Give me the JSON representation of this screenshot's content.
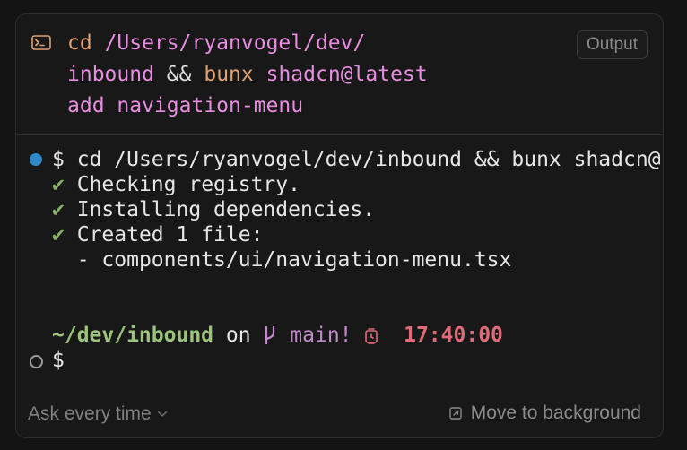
{
  "header": {
    "command_lines": [
      {
        "cd": "cd",
        "path": "/Users/ryanvogel/dev/"
      },
      {
        "dir": "inbound",
        "op": "&&",
        "bunx": "bunx",
        "pkg": "shadcn@latest"
      },
      {
        "rest": "add navigation-menu"
      }
    ],
    "output_label": "Output"
  },
  "terminal": {
    "prompt": "$",
    "command": "cd /Users/ryanvogel/dev/inbound && bunx shadcn@",
    "check_mark": "✔",
    "lines": [
      "Checking registry.",
      "Installing dependencies.",
      "Created 1 file:"
    ],
    "file_line": "- components/ui/navigation-menu.tsx",
    "status": {
      "path": "~/dev/inbound",
      "on": "on",
      "branch": "main!",
      "time": "17:40:00"
    },
    "prompt2": "$"
  },
  "footer": {
    "ask_label": "Ask every time",
    "move_label": "Move to background"
  },
  "colors": {
    "accent_dot": "#2e8ac8",
    "check": "#8ab06a",
    "path": "#9cc37a",
    "branch": "#c48ad0",
    "time": "#e06a78"
  },
  "icons": [
    "terminal-icon",
    "git-branch-icon",
    "clock-icon",
    "chevron-down-icon",
    "move-to-background-icon"
  ]
}
